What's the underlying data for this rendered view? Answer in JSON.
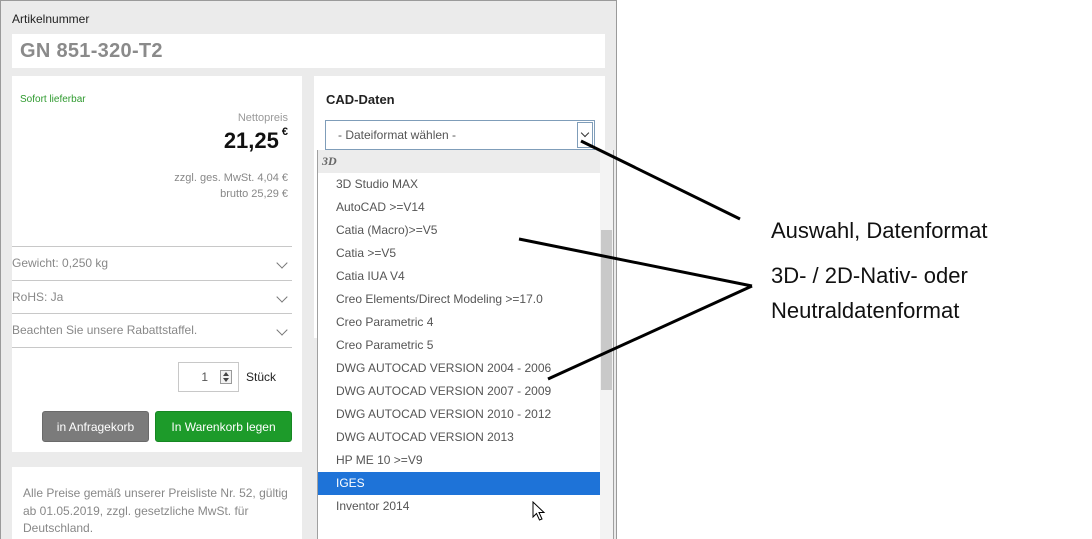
{
  "article": {
    "label": "Artikelnummer",
    "number": "GN 851-320-T2"
  },
  "pricing": {
    "availability": "Sofort lieferbar",
    "net_label": "Nettopreis",
    "price": "21,25",
    "currency": "€",
    "vat": "zzgl. ges. MwSt. 4,04 €",
    "gross": "brutto 25,29 €"
  },
  "details": [
    {
      "label": "Gewicht: 0,250 kg"
    },
    {
      "label": "RoHS: Ja"
    },
    {
      "label": "Beachten Sie unsere Rabattstaffel."
    }
  ],
  "quantity": {
    "value": "1",
    "unit": "Stück"
  },
  "buttons": {
    "inquiry": "in Anfragekorb",
    "cart": "In Warenkorb legen"
  },
  "footer_note": "Alle Preise gemäß unserer Preisliste Nr. 52, gültig ab 01.05.2019, zzgl. gesetzliche MwSt. für Deutschland.",
  "cad": {
    "title": "CAD-Daten",
    "select_placeholder": "- Dateiformat wählen -",
    "group": "3D",
    "options": [
      "3D Studio MAX",
      "AutoCAD >=V14",
      "Catia (Macro)>=V5",
      "Catia >=V5",
      "Catia IUA V4",
      "Creo Elements/Direct Modeling >=17.0",
      "Creo Parametric 4",
      "Creo Parametric 5",
      "DWG AUTOCAD VERSION 2004 - 2006",
      "DWG AUTOCAD VERSION 2007 - 2009",
      "DWG AUTOCAD VERSION 2010 - 2012",
      "DWG AUTOCAD VERSION 2013",
      "HP ME 10 >=V9",
      "IGES",
      "Inventor 2014"
    ],
    "selected_option": "IGES"
  },
  "callouts": {
    "format_selection": "Auswahl, Datenformat",
    "native_line1": "3D- / 2D-Nativ- oder",
    "native_line2": "Neutraldatenformat"
  },
  "colors": {
    "green_button": "#1d9b2a",
    "gray_button": "#7b7b7b",
    "selection_blue": "#1e73d8",
    "availability_green": "#2f9a2f"
  }
}
